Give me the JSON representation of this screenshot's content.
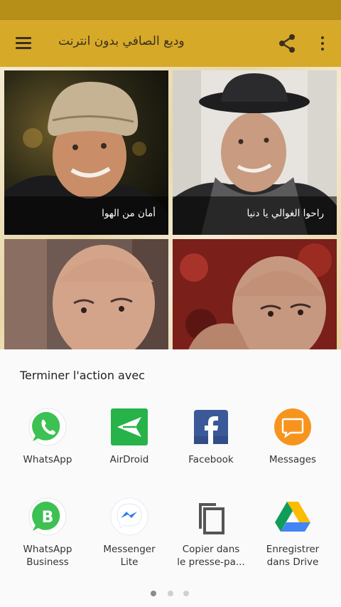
{
  "app_bar": {
    "title": "وديع الصافي بدون انترنت",
    "color": "#d6a928",
    "status_color": "#b58f18"
  },
  "songs": [
    {
      "title": "أمان من الهوا"
    },
    {
      "title": "راحوا الغوالي يا دنيا"
    },
    {
      "title": ""
    },
    {
      "title": ""
    }
  ],
  "share_sheet": {
    "title": "Terminer l'action avec",
    "apps": [
      {
        "label": "WhatsApp",
        "icon": "whatsapp-icon"
      },
      {
        "label": "AirDroid",
        "icon": "airdroid-icon"
      },
      {
        "label": "Facebook",
        "icon": "facebook-icon"
      },
      {
        "label": "Messages",
        "icon": "messages-icon"
      },
      {
        "label_line1": "WhatsApp",
        "label_line2": "Business",
        "icon": "whatsapp-business-icon"
      },
      {
        "label_line1": "Messenger",
        "label_line2": "Lite",
        "icon": "messenger-lite-icon"
      },
      {
        "label_line1": "Copier dans",
        "label_line2": "le presse-pa...",
        "icon": "copy-icon"
      },
      {
        "label_line1": "Enregistrer",
        "label_line2": "dans Drive",
        "icon": "google-drive-icon"
      }
    ],
    "page_count": 3,
    "current_page": 1
  }
}
